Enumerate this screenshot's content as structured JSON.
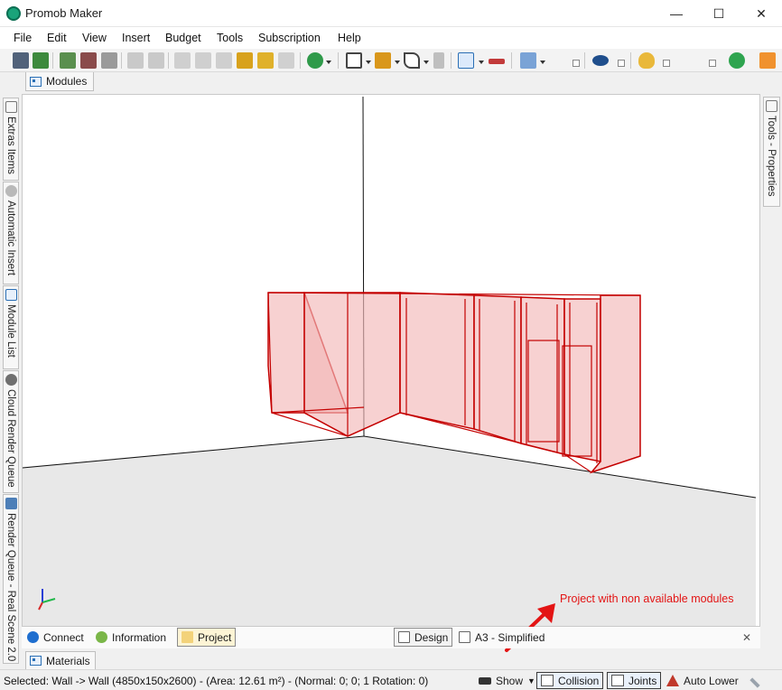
{
  "window": {
    "title": "Promob Maker",
    "minimize_glyph": "—",
    "maximize_glyph": "☐",
    "close_glyph": "✕"
  },
  "menu": [
    "File",
    "Edit",
    "View",
    "Insert",
    "Budget",
    "Tools",
    "Subscription",
    "Help"
  ],
  "toolbar": {
    "icons": [
      "save-icon",
      "export-icon",
      "print-icon",
      "print-preview-icon",
      "printer-icon",
      "undo-icon",
      "redo-icon",
      "cut-icon",
      "copy-icon",
      "paste-icon",
      "hammer-icon",
      "paint-roller-icon",
      "delete-icon",
      "budget-dollar-icon",
      "group-icon",
      "layout-icon",
      "shape-icon",
      "panel-icon",
      "select-cursor-icon",
      "measure-icon",
      "layers-icon",
      "eye-icon",
      "light-bulb-icon",
      "check-icon",
      "user-icon"
    ]
  },
  "tabs": {
    "modules": "Modules",
    "materials": "Materials"
  },
  "left_rail": [
    "Extras Items",
    "Automatic Insert",
    "Module List",
    "Cloud Render Queue",
    "Render Queue - Real Scene 2.0"
  ],
  "right_rail": [
    "Tools - Properties"
  ],
  "annotation": {
    "text": "Project with non available modules",
    "color": "#e31414"
  },
  "bottom_tabs": {
    "left": [
      "Connect",
      "Information",
      "Project"
    ],
    "active_left": "Project",
    "right": [
      "Design",
      "A3 - Simplified"
    ],
    "active_right": "Design",
    "close_glyph": "✕"
  },
  "status": {
    "selected": "Selected: Wall -> Wall (4850x150x2600) - (Area: 12.61 m²) - (Normal: 0; 0; 1 Rotation: 0)",
    "show": "Show",
    "collision": "Collision",
    "joints": "Joints",
    "auto_lower": "Auto Lower"
  },
  "colors": {
    "model_outline": "#c40000",
    "model_fill": "#f3b9b9",
    "floor": "#e8e8e8",
    "accent_blue": "#2a6fb5"
  }
}
